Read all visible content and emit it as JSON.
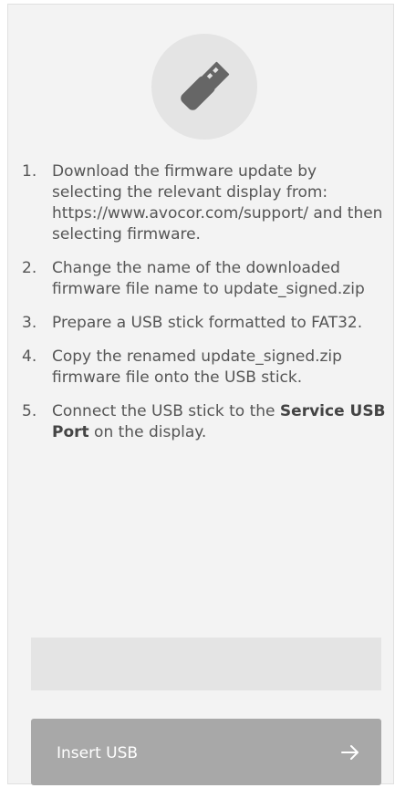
{
  "icons": {
    "usb": "usb-stick-icon",
    "arrow": "arrow-right-icon"
  },
  "steps": [
    {
      "number": "1.",
      "text": "Download the firmware update by selecting the relevant display from: https://www.avocor.com/support/ and then selecting firmware."
    },
    {
      "number": "2.",
      "text": "Change the name of the downloaded firmware file name to update_signed.zip"
    },
    {
      "number": "3.",
      "text": "Prepare a USB stick formatted to FAT32."
    },
    {
      "number": "4.",
      "text": "Copy the renamed update_signed.zip firmware file onto the USB stick."
    },
    {
      "number": "5.",
      "text_before": "Connect the USB stick to the ",
      "bold": "Service USB Port",
      "text_after": " on the display."
    }
  ],
  "status_box": {
    "text": ""
  },
  "button": {
    "label": "Insert USB"
  },
  "colors": {
    "panel_bg": "#f3f3f3",
    "circle_bg": "#e4e4e4",
    "text": "#555555",
    "button_bg": "#a8a8a8",
    "button_text": "#ffffff"
  }
}
